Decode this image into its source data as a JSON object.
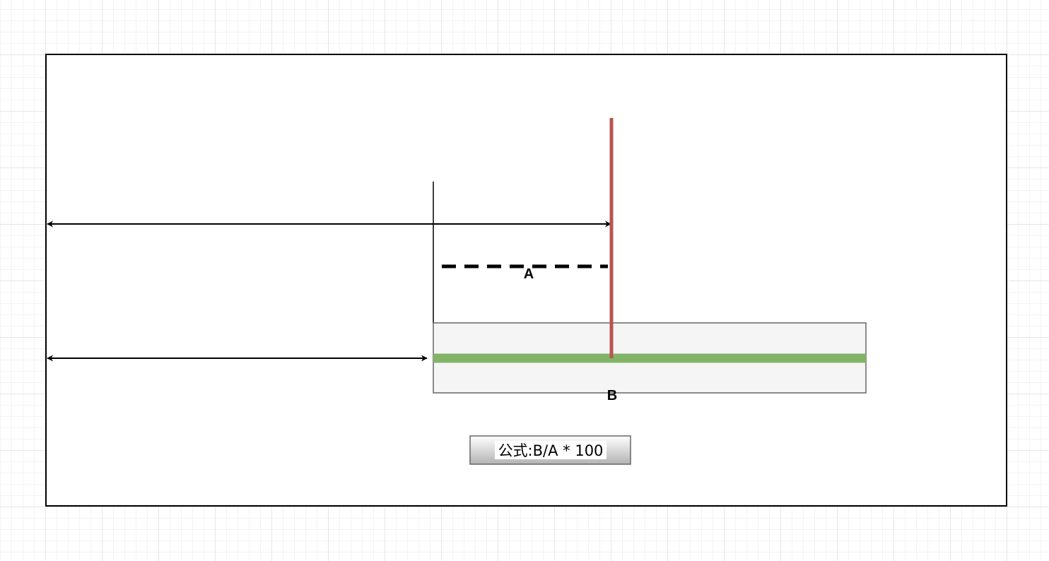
{
  "diagram": {
    "label_a": "A",
    "label_b": "B",
    "formula": "公式:B/A * 100"
  },
  "colors": {
    "frame_border": "#000000",
    "red_marker": "#b85450",
    "green_bar": "#82b366",
    "track_fill": "#f5f5f5",
    "track_border": "#666666",
    "formula_fill_top": "#ffffff",
    "formula_fill_bottom": "#b3b3b3",
    "formula_border": "#666666"
  }
}
